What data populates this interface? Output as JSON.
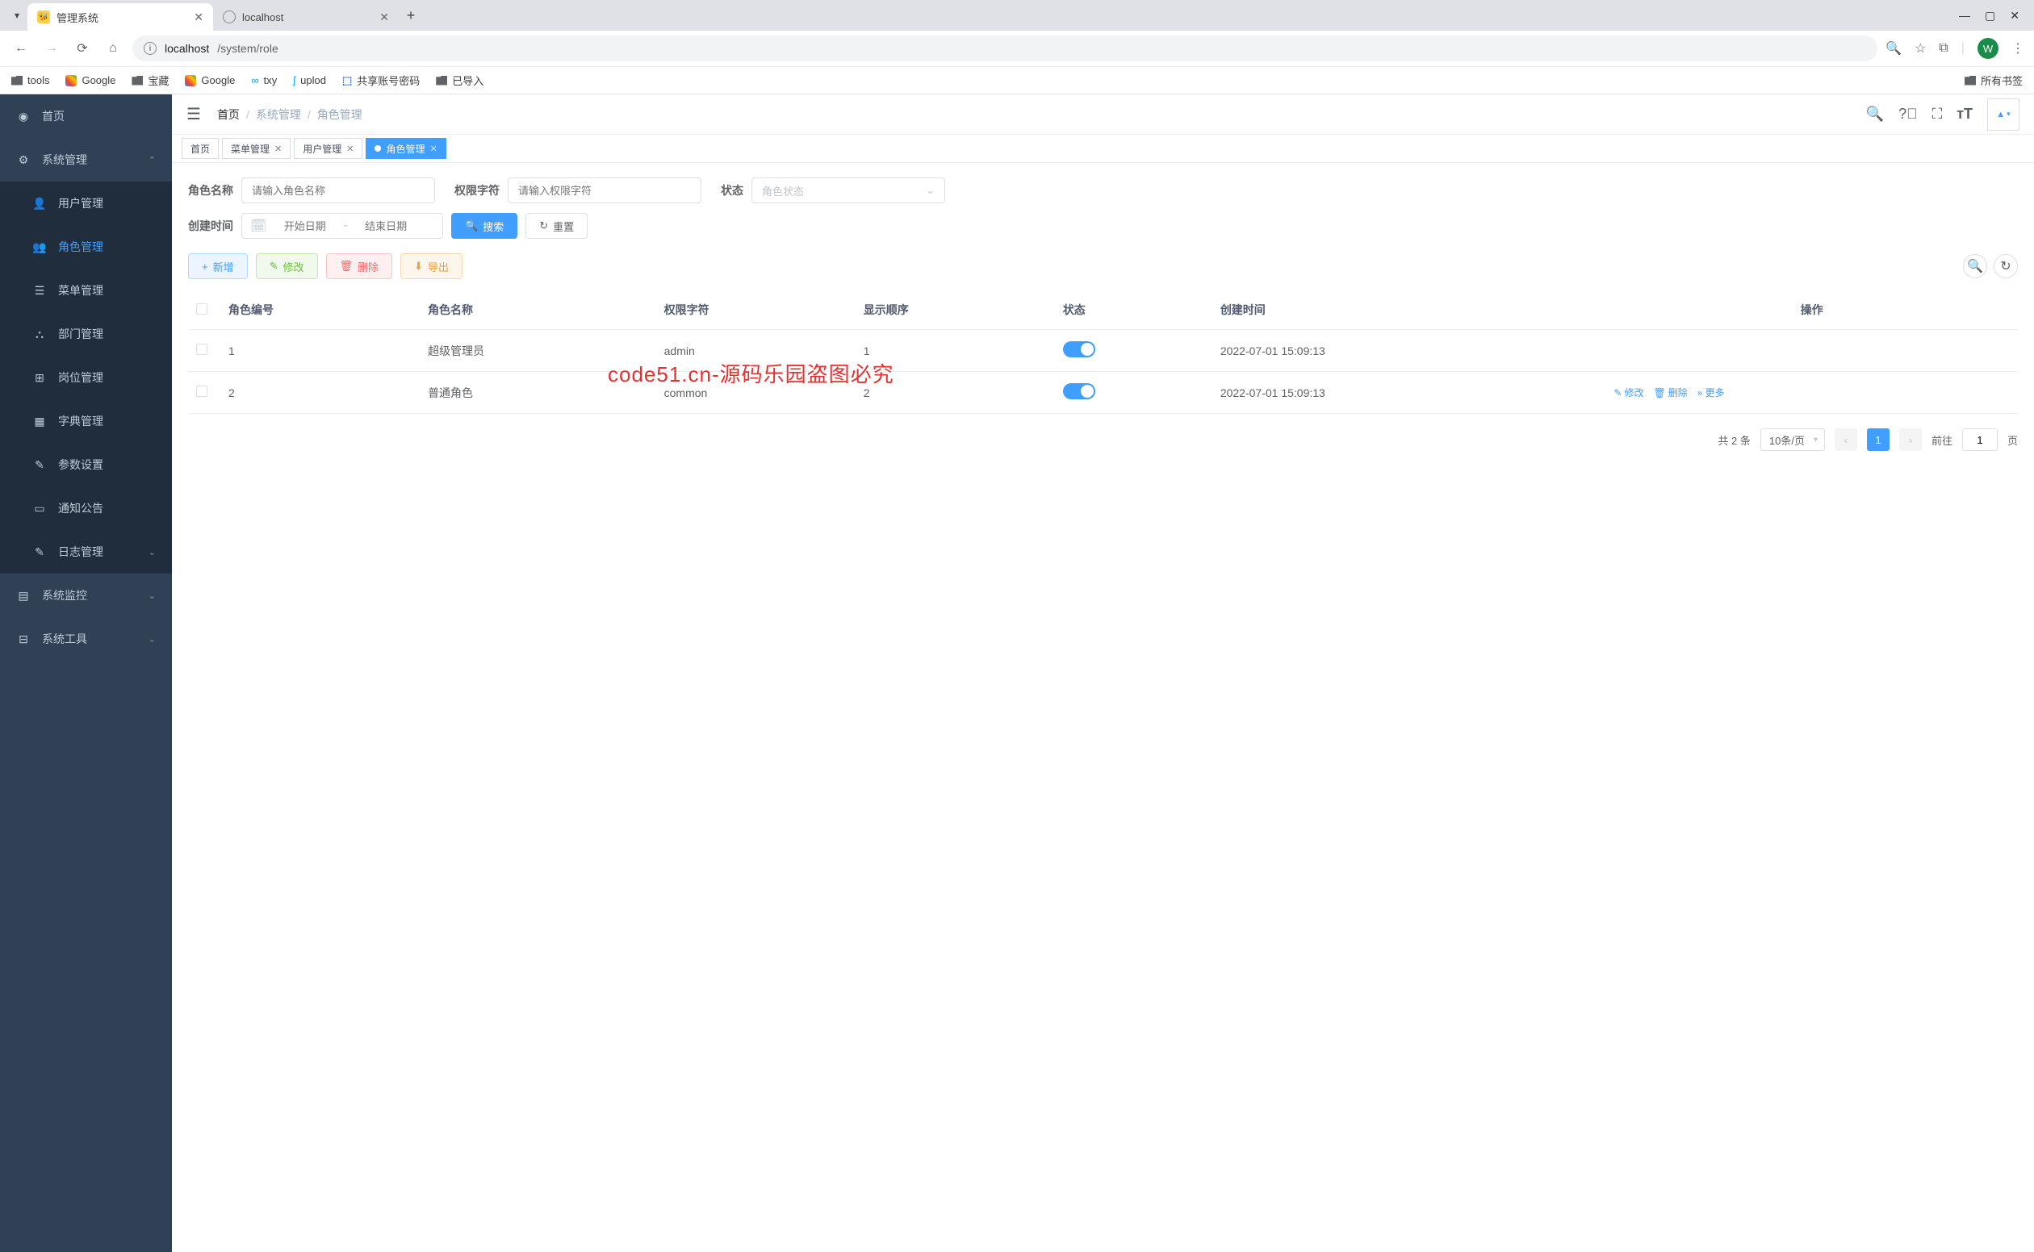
{
  "browser": {
    "tabs": [
      {
        "title": "管理系统",
        "active": true
      },
      {
        "title": "localhost",
        "active": false
      }
    ],
    "url_host": "localhost",
    "url_path": "/system/role",
    "profile_letter": "W",
    "bookmarks": [
      "tools",
      "Google",
      "宝藏",
      "Google",
      "txy",
      "uplod",
      "共享账号密码",
      "已导入"
    ],
    "all_bookmarks": "所有书签"
  },
  "sidebar": {
    "items": [
      {
        "label": "首页",
        "level": 1
      },
      {
        "label": "系统管理",
        "level": 1,
        "expanded": true
      },
      {
        "label": "用户管理",
        "level": 2
      },
      {
        "label": "角色管理",
        "level": 2,
        "active": true
      },
      {
        "label": "菜单管理",
        "level": 2
      },
      {
        "label": "部门管理",
        "level": 2
      },
      {
        "label": "岗位管理",
        "level": 2
      },
      {
        "label": "字典管理",
        "level": 2
      },
      {
        "label": "参数设置",
        "level": 2
      },
      {
        "label": "通知公告",
        "level": 2
      },
      {
        "label": "日志管理",
        "level": 2,
        "chev": true
      },
      {
        "label": "系统监控",
        "level": 1,
        "chev": true
      },
      {
        "label": "系统工具",
        "level": 1,
        "chev": true
      }
    ]
  },
  "breadcrumb": {
    "home": "首页",
    "group": "系统管理",
    "page": "角色管理"
  },
  "view_tabs": [
    {
      "label": "首页",
      "closable": false
    },
    {
      "label": "菜单管理",
      "closable": true
    },
    {
      "label": "用户管理",
      "closable": true
    },
    {
      "label": "角色管理",
      "closable": true,
      "active": true
    }
  ],
  "filters": {
    "role_name_label": "角色名称",
    "role_name_ph": "请输入角色名称",
    "perm_label": "权限字符",
    "perm_ph": "请输入权限字符",
    "status_label": "状态",
    "status_ph": "角色状态",
    "create_label": "创建时间",
    "start_ph": "开始日期",
    "end_ph": "结束日期",
    "search_btn": "搜索",
    "reset_btn": "重置"
  },
  "actions": {
    "add": "新增",
    "edit": "修改",
    "del": "删除",
    "export": "导出"
  },
  "table": {
    "cols": [
      "",
      "角色编号",
      "角色名称",
      "权限字符",
      "显示顺序",
      "状态",
      "创建时间",
      "操作"
    ],
    "rows": [
      {
        "id": "1",
        "name": "超级管理员",
        "perm": "admin",
        "order": "1",
        "status": true,
        "created": "2022-07-01 15:09:13",
        "ops": false
      },
      {
        "id": "2",
        "name": "普通角色",
        "perm": "common",
        "order": "2",
        "status": true,
        "created": "2022-07-01 15:09:13",
        "ops": true
      }
    ],
    "op_edit": "修改",
    "op_del": "删除",
    "op_more": "更多"
  },
  "pager": {
    "total_text": "共 2 条",
    "page_size": "10条/页",
    "current": "1",
    "goto_prefix": "前往",
    "goto_input": "1",
    "goto_suffix": "页"
  },
  "watermark": "code51.cn-源码乐园盗图必究"
}
